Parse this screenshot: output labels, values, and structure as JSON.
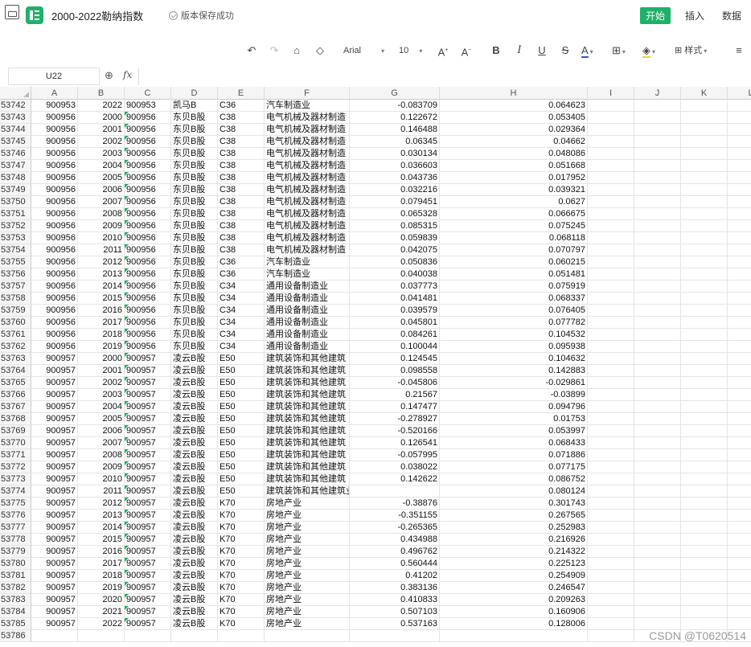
{
  "app": {
    "doc_title": "2000-2022勒纳指数",
    "save_status": "版本保存成功",
    "tabs": [
      "开始",
      "插入",
      "数据"
    ],
    "accent": "#1fb16a"
  },
  "toolbar": {
    "font_name": "Arial",
    "font_size": "10",
    "style_label": "样式"
  },
  "formula": {
    "cell_ref": "U22",
    "fx_label": "fx",
    "value": ""
  },
  "columns": [
    "A",
    "B",
    "C",
    "D",
    "E",
    "F",
    "G",
    "H",
    "I",
    "J",
    "K",
    "L"
  ],
  "rows": [
    {
      "n": "53742",
      "a": "900953",
      "b": "2022",
      "c": "900953",
      "d": "凯马B",
      "e": "C36",
      "f": "汽车制造业",
      "g": "-0.083709",
      "h": "0.064623",
      "flag": false
    },
    {
      "n": "53743",
      "a": "900956",
      "b": "2000",
      "c": "900956",
      "d": "东贝B股",
      "e": "C38",
      "f": "电气机械及器材制造",
      "g": "0.122672",
      "h": "0.053405",
      "flag": true
    },
    {
      "n": "53744",
      "a": "900956",
      "b": "2001",
      "c": "900956",
      "d": "东贝B股",
      "e": "C38",
      "f": "电气机械及器材制造",
      "g": "0.146488",
      "h": "0.029364",
      "flag": true
    },
    {
      "n": "53745",
      "a": "900956",
      "b": "2002",
      "c": "900956",
      "d": "东贝B股",
      "e": "C38",
      "f": "电气机械及器材制造",
      "g": "0.06345",
      "h": "0.04662",
      "flag": true
    },
    {
      "n": "53746",
      "a": "900956",
      "b": "2003",
      "c": "900956",
      "d": "东贝B股",
      "e": "C38",
      "f": "电气机械及器材制造",
      "g": "0.030134",
      "h": "0.048086",
      "flag": true
    },
    {
      "n": "53747",
      "a": "900956",
      "b": "2004",
      "c": "900956",
      "d": "东贝B股",
      "e": "C38",
      "f": "电气机械及器材制造",
      "g": "0.036603",
      "h": "0.051668",
      "flag": true
    },
    {
      "n": "53748",
      "a": "900956",
      "b": "2005",
      "c": "900956",
      "d": "东贝B股",
      "e": "C38",
      "f": "电气机械及器材制造",
      "g": "0.043736",
      "h": "0.017952",
      "flag": true
    },
    {
      "n": "53749",
      "a": "900956",
      "b": "2006",
      "c": "900956",
      "d": "东贝B股",
      "e": "C38",
      "f": "电气机械及器材制造",
      "g": "0.032216",
      "h": "0.039321",
      "flag": true
    },
    {
      "n": "53750",
      "a": "900956",
      "b": "2007",
      "c": "900956",
      "d": "东贝B股",
      "e": "C38",
      "f": "电气机械及器材制造",
      "g": "0.079451",
      "h": "0.0627",
      "flag": true
    },
    {
      "n": "53751",
      "a": "900956",
      "b": "2008",
      "c": "900956",
      "d": "东贝B股",
      "e": "C38",
      "f": "电气机械及器材制造",
      "g": "0.065328",
      "h": "0.066675",
      "flag": true
    },
    {
      "n": "53752",
      "a": "900956",
      "b": "2009",
      "c": "900956",
      "d": "东贝B股",
      "e": "C38",
      "f": "电气机械及器材制造",
      "g": "0.085315",
      "h": "0.075245",
      "flag": true
    },
    {
      "n": "53753",
      "a": "900956",
      "b": "2010",
      "c": "900956",
      "d": "东贝B股",
      "e": "C38",
      "f": "电气机械及器材制造",
      "g": "0.059839",
      "h": "0.068118",
      "flag": true
    },
    {
      "n": "53754",
      "a": "900956",
      "b": "2011",
      "c": "900956",
      "d": "东贝B股",
      "e": "C38",
      "f": "电气机械及器材制造",
      "g": "0.042075",
      "h": "0.070797",
      "flag": true
    },
    {
      "n": "53755",
      "a": "900956",
      "b": "2012",
      "c": "900956",
      "d": "东贝B股",
      "e": "C36",
      "f": "汽车制造业",
      "g": "0.050836",
      "h": "0.060215",
      "flag": true
    },
    {
      "n": "53756",
      "a": "900956",
      "b": "2013",
      "c": "900956",
      "d": "东贝B股",
      "e": "C36",
      "f": "汽车制造业",
      "g": "0.040038",
      "h": "0.051481",
      "flag": true
    },
    {
      "n": "53757",
      "a": "900956",
      "b": "2014",
      "c": "900956",
      "d": "东贝B股",
      "e": "C34",
      "f": "通用设备制造业",
      "g": "0.037773",
      "h": "0.075919",
      "flag": true
    },
    {
      "n": "53758",
      "a": "900956",
      "b": "2015",
      "c": "900956",
      "d": "东贝B股",
      "e": "C34",
      "f": "通用设备制造业",
      "g": "0.041481",
      "h": "0.068337",
      "flag": true
    },
    {
      "n": "53759",
      "a": "900956",
      "b": "2016",
      "c": "900956",
      "d": "东贝B股",
      "e": "C34",
      "f": "通用设备制造业",
      "g": "0.039579",
      "h": "0.076405",
      "flag": true
    },
    {
      "n": "53760",
      "a": "900956",
      "b": "2017",
      "c": "900956",
      "d": "东贝B股",
      "e": "C34",
      "f": "通用设备制造业",
      "g": "0.045801",
      "h": "0.077782",
      "flag": true
    },
    {
      "n": "53761",
      "a": "900956",
      "b": "2018",
      "c": "900956",
      "d": "东贝B股",
      "e": "C34",
      "f": "通用设备制造业",
      "g": "0.084261",
      "h": "0.104532",
      "flag": true
    },
    {
      "n": "53762",
      "a": "900956",
      "b": "2019",
      "c": "900956",
      "d": "东贝B股",
      "e": "C34",
      "f": "通用设备制造业",
      "g": "0.100044",
      "h": "0.095938",
      "flag": true
    },
    {
      "n": "53763",
      "a": "900957",
      "b": "2000",
      "c": "900957",
      "d": "凌云B股",
      "e": "E50",
      "f": "建筑装饰和其他建筑",
      "g": "0.124545",
      "h": "0.104632",
      "flag": true
    },
    {
      "n": "53764",
      "a": "900957",
      "b": "2001",
      "c": "900957",
      "d": "凌云B股",
      "e": "E50",
      "f": "建筑装饰和其他建筑",
      "g": "0.098558",
      "h": "0.142883",
      "flag": true
    },
    {
      "n": "53765",
      "a": "900957",
      "b": "2002",
      "c": "900957",
      "d": "凌云B股",
      "e": "E50",
      "f": "建筑装饰和其他建筑",
      "g": "-0.045806",
      "h": "-0.029861",
      "flag": true
    },
    {
      "n": "53766",
      "a": "900957",
      "b": "2003",
      "c": "900957",
      "d": "凌云B股",
      "e": "E50",
      "f": "建筑装饰和其他建筑",
      "g": "0.21567",
      "h": "-0.03899",
      "flag": true
    },
    {
      "n": "53767",
      "a": "900957",
      "b": "2004",
      "c": "900957",
      "d": "凌云B股",
      "e": "E50",
      "f": "建筑装饰和其他建筑",
      "g": "0.147477",
      "h": "0.094796",
      "flag": true
    },
    {
      "n": "53768",
      "a": "900957",
      "b": "2005",
      "c": "900957",
      "d": "凌云B股",
      "e": "E50",
      "f": "建筑装饰和其他建筑",
      "g": "-0.278927",
      "h": "0.01753",
      "flag": true
    },
    {
      "n": "53769",
      "a": "900957",
      "b": "2006",
      "c": "900957",
      "d": "凌云B股",
      "e": "E50",
      "f": "建筑装饰和其他建筑",
      "g": "-0.520166",
      "h": "0.053997",
      "flag": true
    },
    {
      "n": "53770",
      "a": "900957",
      "b": "2007",
      "c": "900957",
      "d": "凌云B股",
      "e": "E50",
      "f": "建筑装饰和其他建筑",
      "g": "0.126541",
      "h": "0.068433",
      "flag": true
    },
    {
      "n": "53771",
      "a": "900957",
      "b": "2008",
      "c": "900957",
      "d": "凌云B股",
      "e": "E50",
      "f": "建筑装饰和其他建筑",
      "g": "-0.057995",
      "h": "0.071886",
      "flag": true
    },
    {
      "n": "53772",
      "a": "900957",
      "b": "2009",
      "c": "900957",
      "d": "凌云B股",
      "e": "E50",
      "f": "建筑装饰和其他建筑",
      "g": "0.038022",
      "h": "0.077175",
      "flag": true
    },
    {
      "n": "53773",
      "a": "900957",
      "b": "2010",
      "c": "900957",
      "d": "凌云B股",
      "e": "E50",
      "f": "建筑装饰和其他建筑",
      "g": "0.142622",
      "h": "0.086752",
      "flag": true
    },
    {
      "n": "53774",
      "a": "900957",
      "b": "2011",
      "c": "900957",
      "d": "凌云B股",
      "e": "E50",
      "f": "建筑装饰和其他建筑业",
      "g": "",
      "h": "0.080124",
      "flag": true
    },
    {
      "n": "53775",
      "a": "900957",
      "b": "2012",
      "c": "900957",
      "d": "凌云B股",
      "e": "K70",
      "f": "房地产业",
      "g": "-0.38876",
      "h": "0.301743",
      "flag": true
    },
    {
      "n": "53776",
      "a": "900957",
      "b": "2013",
      "c": "900957",
      "d": "凌云B股",
      "e": "K70",
      "f": "房地产业",
      "g": "-0.351155",
      "h": "0.267565",
      "flag": true
    },
    {
      "n": "53777",
      "a": "900957",
      "b": "2014",
      "c": "900957",
      "d": "凌云B股",
      "e": "K70",
      "f": "房地产业",
      "g": "-0.265365",
      "h": "0.252983",
      "flag": true
    },
    {
      "n": "53778",
      "a": "900957",
      "b": "2015",
      "c": "900957",
      "d": "凌云B股",
      "e": "K70",
      "f": "房地产业",
      "g": "0.434988",
      "h": "0.216926",
      "flag": true
    },
    {
      "n": "53779",
      "a": "900957",
      "b": "2016",
      "c": "900957",
      "d": "凌云B股",
      "e": "K70",
      "f": "房地产业",
      "g": "0.496762",
      "h": "0.214322",
      "flag": true
    },
    {
      "n": "53780",
      "a": "900957",
      "b": "2017",
      "c": "900957",
      "d": "凌云B股",
      "e": "K70",
      "f": "房地产业",
      "g": "0.560444",
      "h": "0.225123",
      "flag": true
    },
    {
      "n": "53781",
      "a": "900957",
      "b": "2018",
      "c": "900957",
      "d": "凌云B股",
      "e": "K70",
      "f": "房地产业",
      "g": "0.41202",
      "h": "0.254909",
      "flag": true
    },
    {
      "n": "53782",
      "a": "900957",
      "b": "2019",
      "c": "900957",
      "d": "凌云B股",
      "e": "K70",
      "f": "房地产业",
      "g": "0.383136",
      "h": "0.246547",
      "flag": true
    },
    {
      "n": "53783",
      "a": "900957",
      "b": "2020",
      "c": "900957",
      "d": "凌云B股",
      "e": "K70",
      "f": "房地产业",
      "g": "0.410833",
      "h": "0.209263",
      "flag": true
    },
    {
      "n": "53784",
      "a": "900957",
      "b": "2021",
      "c": "900957",
      "d": "凌云B股",
      "e": "K70",
      "f": "房地产业",
      "g": "0.507103",
      "h": "0.160906",
      "flag": true
    },
    {
      "n": "53785",
      "a": "900957",
      "b": "2022",
      "c": "900957",
      "d": "凌云B股",
      "e": "K70",
      "f": "房地产业",
      "g": "0.537163",
      "h": "0.128006",
      "flag": true
    },
    {
      "n": "53786",
      "a": "",
      "b": "",
      "c": "",
      "d": "",
      "e": "",
      "f": "",
      "g": "",
      "h": "",
      "flag": false
    }
  ],
  "watermark": "CSDN @T0620514"
}
